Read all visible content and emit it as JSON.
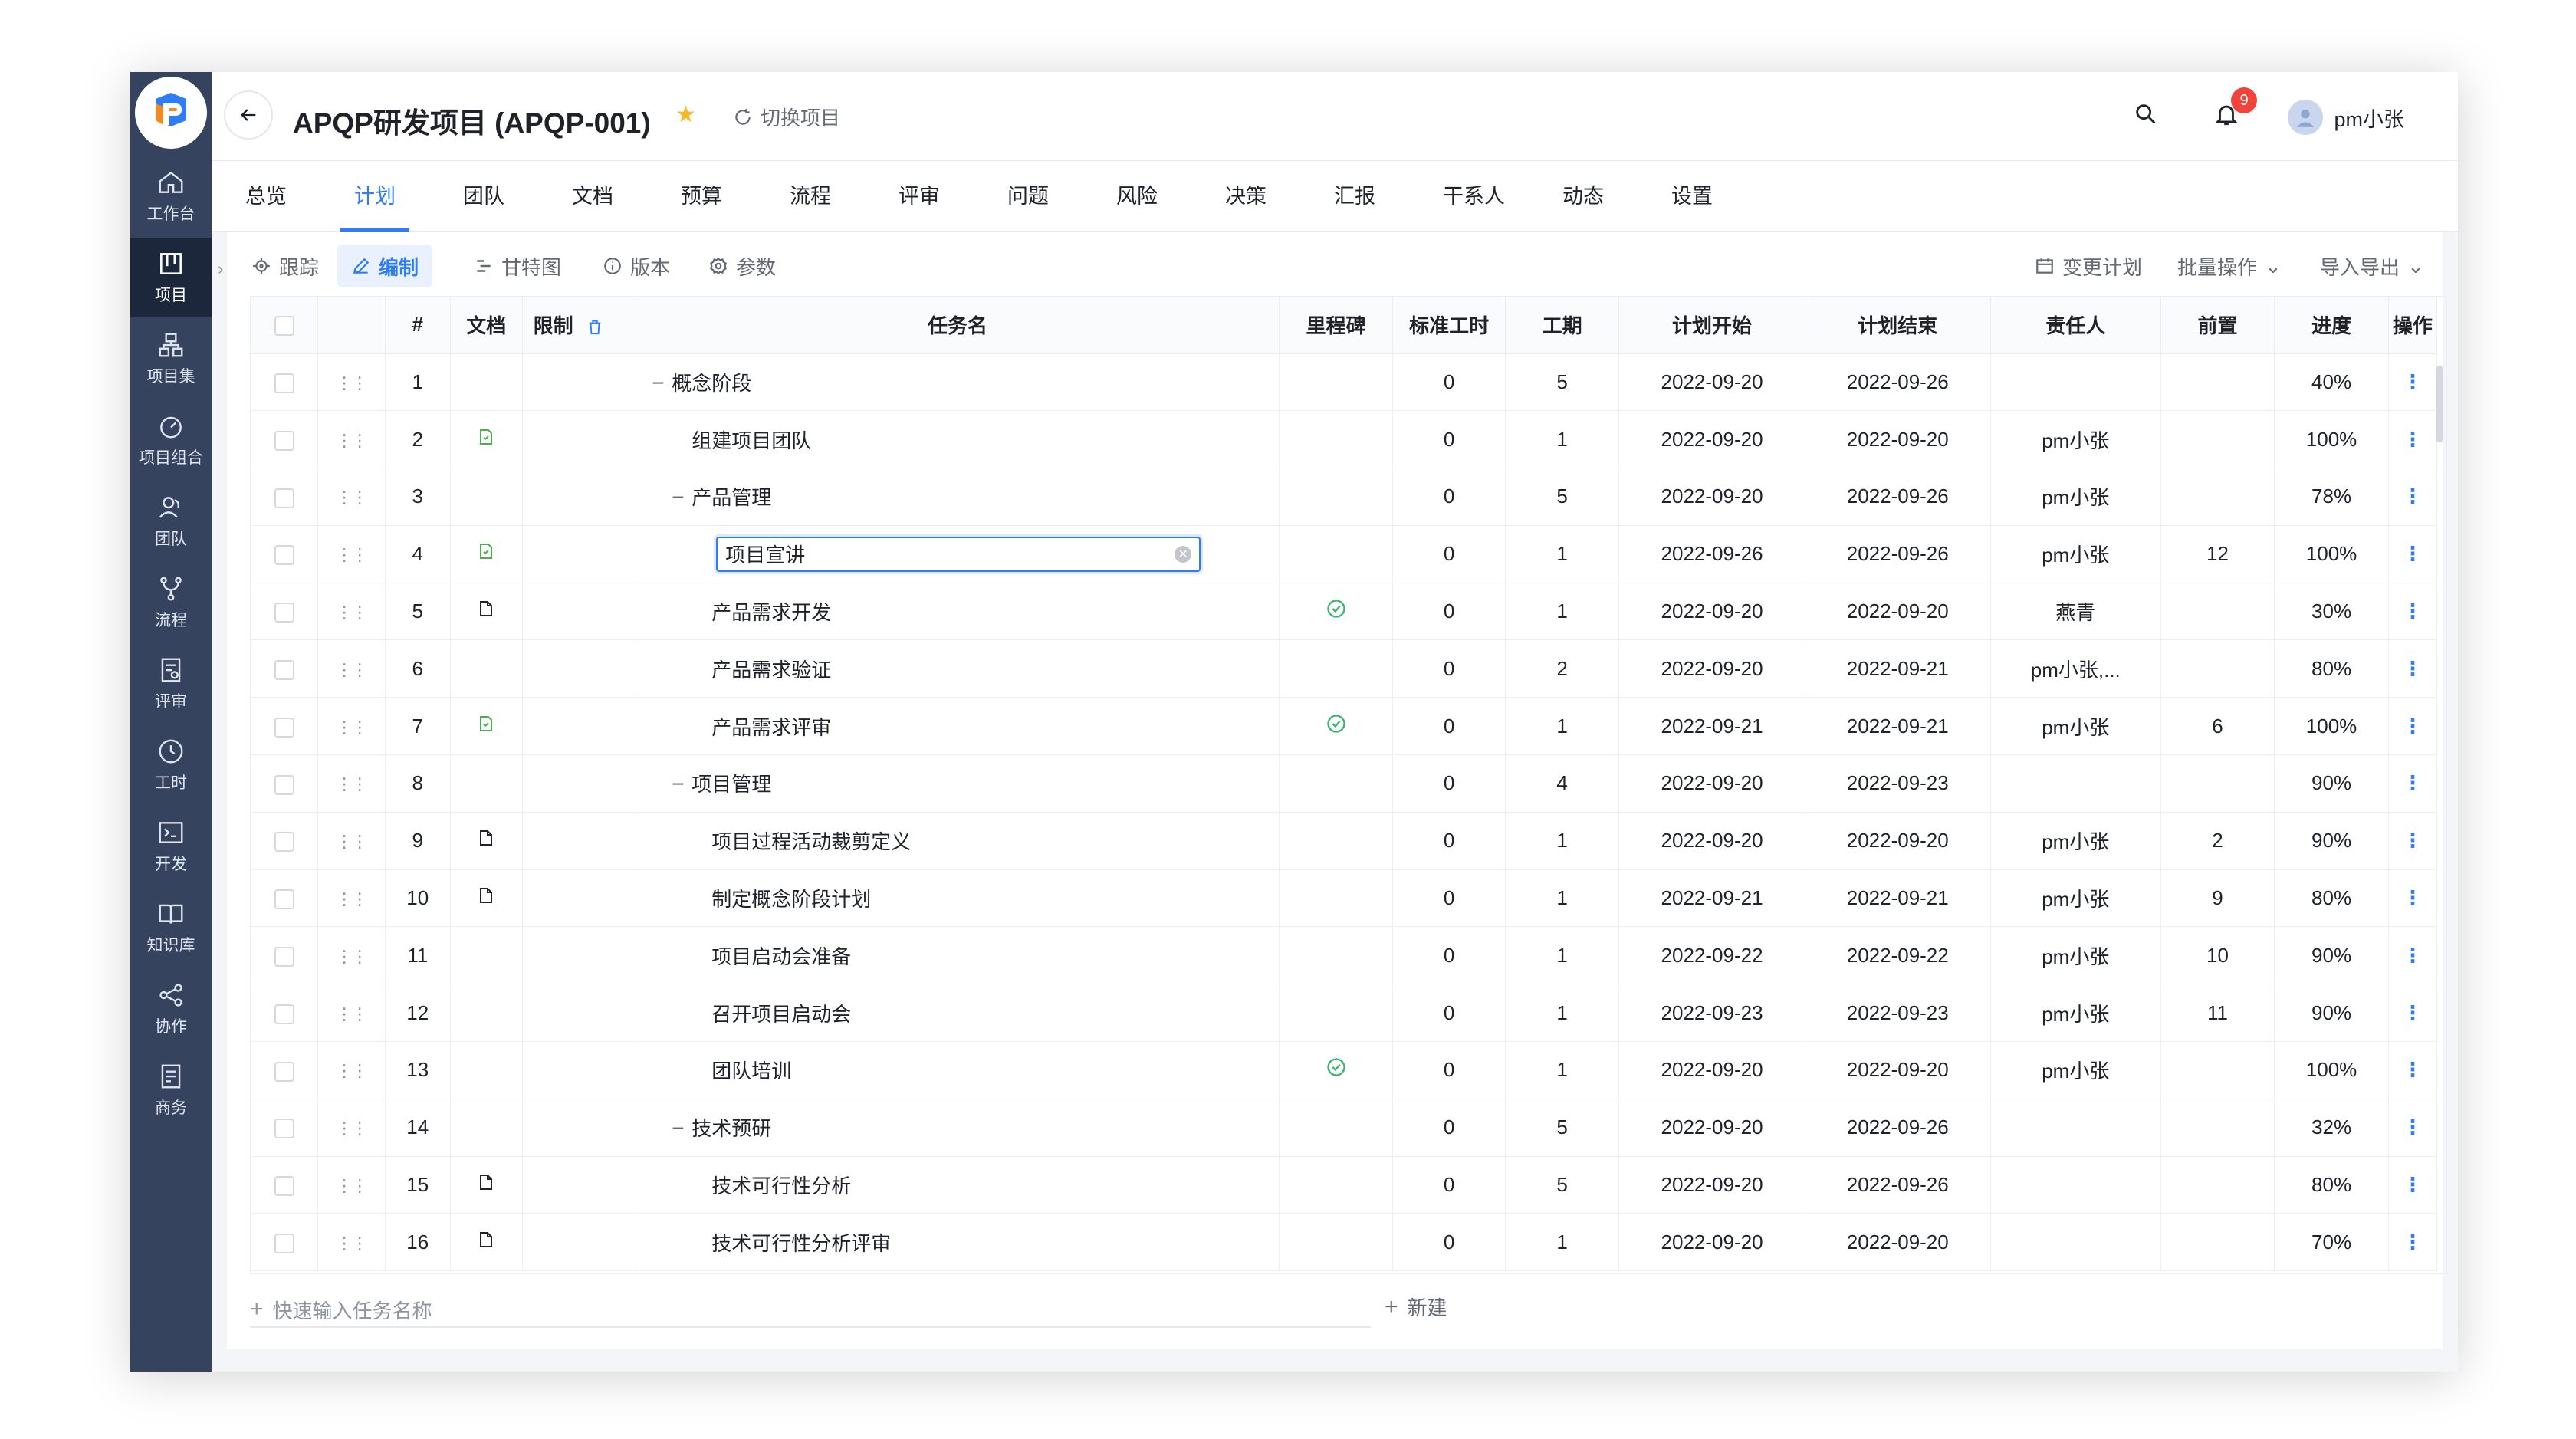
{
  "app": {
    "project_title": "APQP研发项目 (APQP-001)",
    "switch_project": "切换项目",
    "notification_count": "9",
    "user_name": "pm小张"
  },
  "sidebar": {
    "items": [
      {
        "label": "工作台",
        "icon": "home-icon"
      },
      {
        "label": "项目",
        "icon": "board-icon"
      },
      {
        "label": "项目集",
        "icon": "org-icon"
      },
      {
        "label": "项目组合",
        "icon": "dashboard-icon"
      },
      {
        "label": "团队",
        "icon": "team-icon"
      },
      {
        "label": "流程",
        "icon": "branch-icon"
      },
      {
        "label": "评审",
        "icon": "review-icon"
      },
      {
        "label": "工时",
        "icon": "clock-icon"
      },
      {
        "label": "开发",
        "icon": "terminal-icon"
      },
      {
        "label": "知识库",
        "icon": "book-icon"
      },
      {
        "label": "协作",
        "icon": "share-icon"
      },
      {
        "label": "商务",
        "icon": "business-icon"
      }
    ]
  },
  "tabs": [
    "总览",
    "计划",
    "团队",
    "文档",
    "预算",
    "流程",
    "评审",
    "问题",
    "风险",
    "决策",
    "汇报",
    "干系人",
    "动态",
    "设置"
  ],
  "toolbar": {
    "track": "跟踪",
    "edit": "编制",
    "gantt": "甘特图",
    "version": "版本",
    "params": "参数",
    "change_plan": "变更计划",
    "batch_ops": "批量操作",
    "import_export": "导入导出"
  },
  "table": {
    "headers": {
      "num": "#",
      "doc": "文档",
      "limit": "限制",
      "name": "任务名",
      "milestone": "里程碑",
      "std_hours": "标准工时",
      "duration": "工期",
      "plan_start": "计划开始",
      "plan_end": "计划结束",
      "owner": "责任人",
      "predecessor": "前置",
      "progress": "进度",
      "ops": "操作"
    },
    "rows": [
      {
        "n": "1",
        "name": "概念阶段",
        "std": "0",
        "dur": "5",
        "start": "2022-09-20",
        "end": "2022-09-26",
        "owner": "",
        "pre": "",
        "prog": "40%"
      },
      {
        "n": "2",
        "name": "组建项目团队",
        "std": "0",
        "dur": "1",
        "start": "2022-09-20",
        "end": "2022-09-20",
        "owner": "pm小张",
        "pre": "",
        "prog": "100%"
      },
      {
        "n": "3",
        "name": "产品管理",
        "std": "0",
        "dur": "5",
        "start": "2022-09-20",
        "end": "2022-09-26",
        "owner": "pm小张",
        "pre": "",
        "prog": "78%"
      },
      {
        "n": "4",
        "name": "项目宣讲",
        "std": "0",
        "dur": "1",
        "start": "2022-09-26",
        "end": "2022-09-26",
        "owner": "pm小张",
        "pre": "12",
        "prog": "100%"
      },
      {
        "n": "5",
        "name": "产品需求开发",
        "std": "0",
        "dur": "1",
        "start": "2022-09-20",
        "end": "2022-09-20",
        "owner": "燕青",
        "pre": "",
        "prog": "30%"
      },
      {
        "n": "6",
        "name": "产品需求验证",
        "std": "0",
        "dur": "2",
        "start": "2022-09-20",
        "end": "2022-09-21",
        "owner": "pm小张,...",
        "pre": "",
        "prog": "80%"
      },
      {
        "n": "7",
        "name": "产品需求评审",
        "std": "0",
        "dur": "1",
        "start": "2022-09-21",
        "end": "2022-09-21",
        "owner": "pm小张",
        "pre": "6",
        "prog": "100%"
      },
      {
        "n": "8",
        "name": "项目管理",
        "std": "0",
        "dur": "4",
        "start": "2022-09-20",
        "end": "2022-09-23",
        "owner": "",
        "pre": "",
        "prog": "90%"
      },
      {
        "n": "9",
        "name": "项目过程活动裁剪定义",
        "std": "0",
        "dur": "1",
        "start": "2022-09-20",
        "end": "2022-09-20",
        "owner": "pm小张",
        "pre": "2",
        "prog": "90%"
      },
      {
        "n": "10",
        "name": "制定概念阶段计划",
        "std": "0",
        "dur": "1",
        "start": "2022-09-21",
        "end": "2022-09-21",
        "owner": "pm小张",
        "pre": "9",
        "prog": "80%"
      },
      {
        "n": "11",
        "name": "项目启动会准备",
        "std": "0",
        "dur": "1",
        "start": "2022-09-22",
        "end": "2022-09-22",
        "owner": "pm小张",
        "pre": "10",
        "prog": "90%"
      },
      {
        "n": "12",
        "name": "召开项目启动会",
        "std": "0",
        "dur": "1",
        "start": "2022-09-23",
        "end": "2022-09-23",
        "owner": "pm小张",
        "pre": "11",
        "prog": "90%"
      },
      {
        "n": "13",
        "name": "团队培训",
        "std": "0",
        "dur": "1",
        "start": "2022-09-20",
        "end": "2022-09-20",
        "owner": "pm小张",
        "pre": "",
        "prog": "100%"
      },
      {
        "n": "14",
        "name": "技术预研",
        "std": "0",
        "dur": "5",
        "start": "2022-09-20",
        "end": "2022-09-26",
        "owner": "",
        "pre": "",
        "prog": "32%"
      },
      {
        "n": "15",
        "name": "技术可行性分析",
        "std": "0",
        "dur": "5",
        "start": "2022-09-20",
        "end": "2022-09-26",
        "owner": "",
        "pre": "",
        "prog": "80%"
      },
      {
        "n": "16",
        "name": "技术可行性分析评审",
        "std": "0",
        "dur": "1",
        "start": "2022-09-20",
        "end": "2022-09-20",
        "owner": "",
        "pre": "",
        "prog": "70%"
      }
    ]
  },
  "bottom": {
    "quick_input_placeholder": "快速输入任务名称",
    "new_label": "新建"
  },
  "colors": {
    "primary": "#2e7cf6",
    "sidebar": "#36435f",
    "sidebar_active": "#1d273b",
    "milestone_green": "#3bb56c",
    "doc_green": "#4cae4c",
    "badge_red": "#f2433b"
  }
}
